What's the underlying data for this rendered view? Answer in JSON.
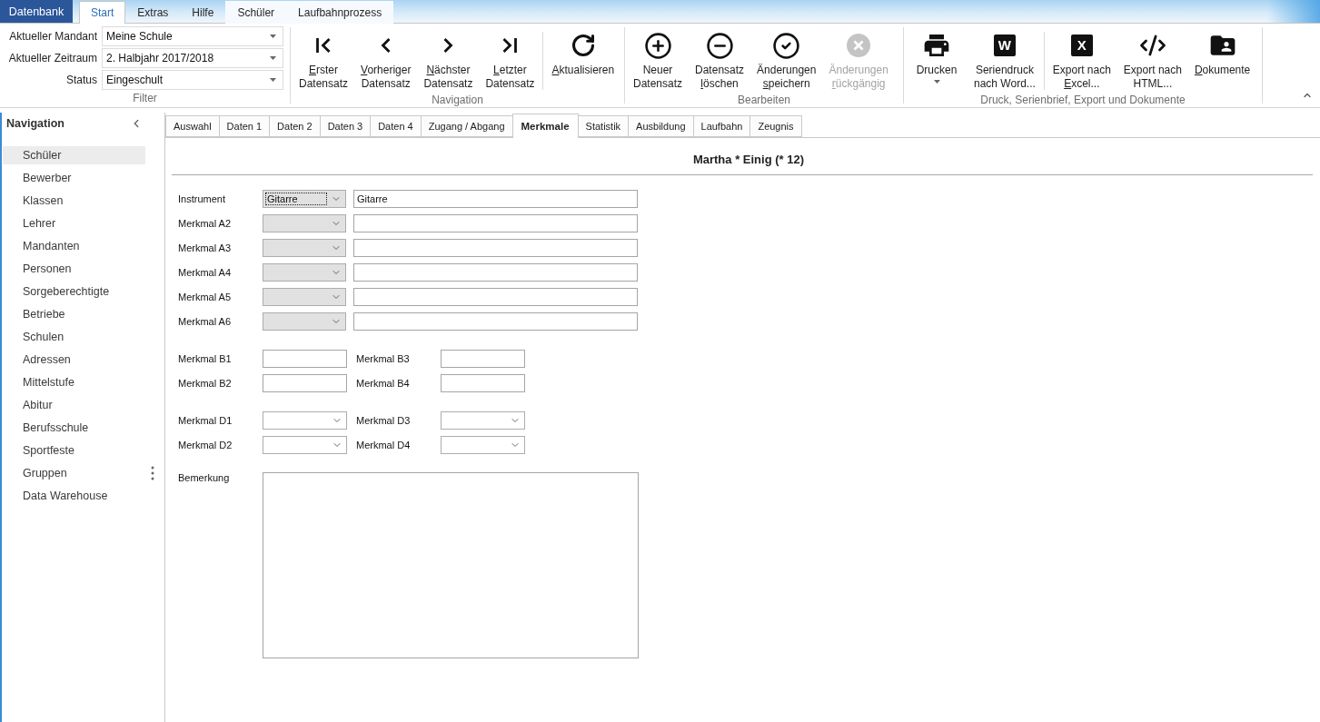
{
  "app_menu": {
    "label": "Datenbank"
  },
  "ribbon_tabs": [
    {
      "label": "Start",
      "selected": true,
      "contextual": false
    },
    {
      "label": "Extras",
      "selected": false,
      "contextual": false
    },
    {
      "label": "Hilfe",
      "selected": false,
      "contextual": false
    },
    {
      "label": "Schüler",
      "selected": false,
      "contextual": true
    },
    {
      "label": "Laufbahnprozess",
      "selected": false,
      "contextual": true
    }
  ],
  "ribbon": {
    "filter": {
      "title": "Filter",
      "fields": [
        {
          "label": "Aktueller Mandant",
          "value": "Meine Schule"
        },
        {
          "label": "Aktueller Zeitraum",
          "value": "2. Halbjahr 2017/2018"
        },
        {
          "label": "Status",
          "value": "Eingeschult"
        }
      ]
    },
    "groups": [
      {
        "title": "Navigation",
        "sections": [
          {
            "buttons": [
              {
                "lines": [
                  {
                    "text": "Erster",
                    "accelerator": true
                  },
                  {
                    "text": "Datensatz",
                    "accelerator": false
                  }
                ],
                "disabled": false,
                "dropdown": false
              },
              {
                "lines": [
                  {
                    "text": "Vorheriger",
                    "accelerator": true
                  },
                  {
                    "text": "Datensatz",
                    "accelerator": false
                  }
                ],
                "disabled": false,
                "dropdown": false
              },
              {
                "lines": [
                  {
                    "text": "Nächster",
                    "accelerator": true
                  },
                  {
                    "text": "Datensatz",
                    "accelerator": false
                  }
                ],
                "disabled": false,
                "dropdown": false
              },
              {
                "lines": [
                  {
                    "text": "Letzter",
                    "accelerator": true
                  },
                  {
                    "text": "Datensatz",
                    "accelerator": false
                  }
                ],
                "disabled": false,
                "dropdown": false
              }
            ]
          },
          {
            "buttons": [
              {
                "lines": [
                  {
                    "text": "Aktualisieren",
                    "accelerator": true
                  }
                ],
                "disabled": false,
                "dropdown": false
              }
            ]
          }
        ]
      },
      {
        "title": "Bearbeiten",
        "sections": [
          {
            "buttons": [
              {
                "lines": [
                  {
                    "text": "Neuer",
                    "accelerator": false
                  },
                  {
                    "text": "Datensatz",
                    "accelerator": false
                  }
                ],
                "disabled": false,
                "dropdown": false
              },
              {
                "lines": [
                  {
                    "text": "Datensatz",
                    "accelerator": false
                  },
                  {
                    "text": "löschen",
                    "accelerator": true
                  }
                ],
                "disabled": false,
                "dropdown": false
              },
              {
                "lines": [
                  {
                    "text": "Änderungen",
                    "accelerator": false
                  },
                  {
                    "text": "speichern",
                    "accelerator": true
                  }
                ],
                "disabled": false,
                "dropdown": false
              },
              {
                "lines": [
                  {
                    "text": "Änderungen",
                    "accelerator": false
                  },
                  {
                    "text": "rückgängig",
                    "accelerator": true
                  }
                ],
                "disabled": true,
                "dropdown": false
              }
            ]
          }
        ]
      },
      {
        "title": "Druck, Serienbrief, Export und Dokumente",
        "sections": [
          {
            "buttons": [
              {
                "lines": [
                  {
                    "text": "Drucken",
                    "accelerator": false
                  }
                ],
                "disabled": false,
                "dropdown": true
              },
              {
                "lines": [
                  {
                    "text": "Seriendruck",
                    "accelerator": false
                  },
                  {
                    "text": "nach Word...",
                    "accelerator": false
                  }
                ],
                "icon_text": "W",
                "disabled": false,
                "dropdown": false
              }
            ]
          },
          {
            "buttons": [
              {
                "lines": [
                  {
                    "text": "Export nach",
                    "accelerator": false
                  },
                  {
                    "text": "Excel...",
                    "accelerator": true
                  }
                ],
                "icon_text": "X",
                "disabled": false,
                "dropdown": false
              },
              {
                "lines": [
                  {
                    "text": "Export nach",
                    "accelerator": false
                  },
                  {
                    "text": "HTML...",
                    "accelerator": false
                  }
                ],
                "disabled": false,
                "dropdown": false
              },
              {
                "lines": [
                  {
                    "text": "Dokumente",
                    "accelerator": true
                  }
                ],
                "disabled": false,
                "dropdown": false
              }
            ]
          }
        ]
      }
    ]
  },
  "navigation": {
    "title": "Navigation",
    "items": [
      {
        "label": "Schüler",
        "selected": true
      },
      {
        "label": "Bewerber",
        "selected": false
      },
      {
        "label": "Klassen",
        "selected": false
      },
      {
        "label": "Lehrer",
        "selected": false
      },
      {
        "label": "Mandanten",
        "selected": false
      },
      {
        "label": "Personen",
        "selected": false
      },
      {
        "label": "Sorgeberechtigte",
        "selected": false
      },
      {
        "label": "Betriebe",
        "selected": false
      },
      {
        "label": "Schulen",
        "selected": false
      },
      {
        "label": "Adressen",
        "selected": false
      },
      {
        "label": "Mittelstufe",
        "selected": false
      },
      {
        "label": "Abitur",
        "selected": false
      },
      {
        "label": "Berufsschule",
        "selected": false
      },
      {
        "label": "Sportfeste",
        "selected": false
      },
      {
        "label": "Gruppen",
        "selected": false
      },
      {
        "label": "Data Warehouse",
        "selected": false
      }
    ]
  },
  "record_tabs": [
    {
      "label": "Auswahl",
      "selected": false
    },
    {
      "label": "Daten 1",
      "selected": false
    },
    {
      "label": "Daten 2",
      "selected": false
    },
    {
      "label": "Daten 3",
      "selected": false
    },
    {
      "label": "Daten 4",
      "selected": false
    },
    {
      "label": "Zugang / Abgang",
      "selected": false
    },
    {
      "label": "Merkmale",
      "selected": true
    },
    {
      "label": "Statistik",
      "selected": false
    },
    {
      "label": "Ausbildung",
      "selected": false
    },
    {
      "label": "Laufbahn",
      "selected": false
    },
    {
      "label": "Zeugnis",
      "selected": false
    }
  ],
  "record": {
    "title": "Martha * Einig (* 12)",
    "a_rows": [
      {
        "label": "Instrument",
        "choice": "Gitarre",
        "focused": true,
        "text": "Gitarre"
      },
      {
        "label": "Merkmal A2",
        "focused": false
      },
      {
        "label": "Merkmal A3",
        "focused": false
      },
      {
        "label": "Merkmal A4",
        "focused": false
      },
      {
        "label": "Merkmal A5",
        "focused": false
      },
      {
        "label": "Merkmal A6",
        "focused": false
      }
    ],
    "b_rows": [
      {
        "fields": [
          {
            "label": "Merkmal B1"
          },
          {
            "label": "Merkmal B3"
          }
        ]
      },
      {
        "fields": [
          {
            "label": "Merkmal B2"
          },
          {
            "label": "Merkmal B4"
          }
        ]
      }
    ],
    "d_rows": [
      {
        "fields": [
          {
            "label": "Merkmal D1"
          },
          {
            "label": "Merkmal D3"
          }
        ]
      },
      {
        "fields": [
          {
            "label": "Merkmal D2"
          },
          {
            "label": "Merkmal D4"
          }
        ]
      }
    ],
    "remark": {
      "label": "Bemerkung"
    }
  }
}
